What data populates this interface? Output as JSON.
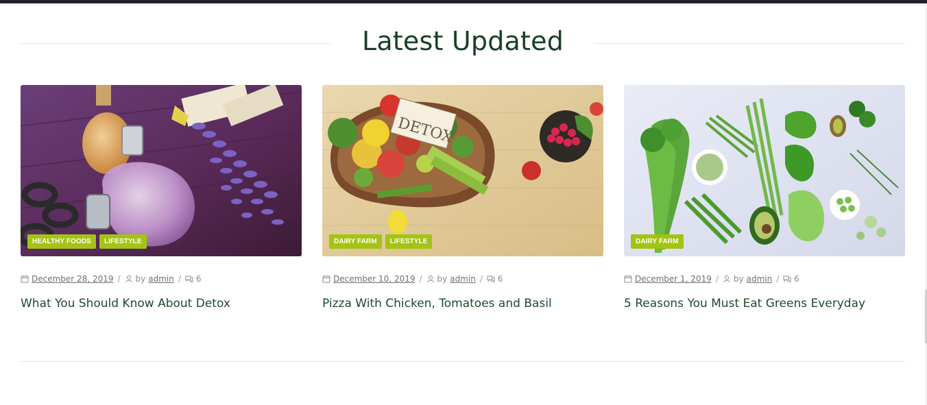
{
  "section": {
    "title": "Latest Updated"
  },
  "posts": [
    {
      "image": "perfume-lavender-photo",
      "tags": [
        "HEALTHY FOODS",
        "LIFESTYLE"
      ],
      "date": "December 28, 2019",
      "by": "by",
      "author": "admin",
      "comments": "6",
      "title": "What You Should Know About Detox"
    },
    {
      "image": "detox-vegetables-bowl-photo",
      "tags": [
        "DAIRY FARM",
        "LIFESTYLE"
      ],
      "date": "December 10, 2019",
      "by": "by",
      "author": "admin",
      "comments": "6",
      "title": "Pizza With Chicken, Tomatoes and Basil"
    },
    {
      "image": "green-vegetables-flatlay-photo",
      "tags": [
        "DAIRY FARM"
      ],
      "date": "December 1, 2019",
      "by": "by",
      "author": "admin",
      "comments": "6",
      "title": "5 Reasons You Must Eat Greens Everyday"
    }
  ],
  "separators": {
    "slash": "/"
  },
  "icons": {
    "date": "calendar-icon",
    "author": "user-icon",
    "comments": "comments-icon"
  },
  "colors": {
    "title": "#173f24",
    "tag_bg": "#a3c413",
    "tag_text": "#ffffff",
    "meta": "#8a8a8a",
    "post_title": "#1d4a2a",
    "topbar": "#1f2228"
  }
}
